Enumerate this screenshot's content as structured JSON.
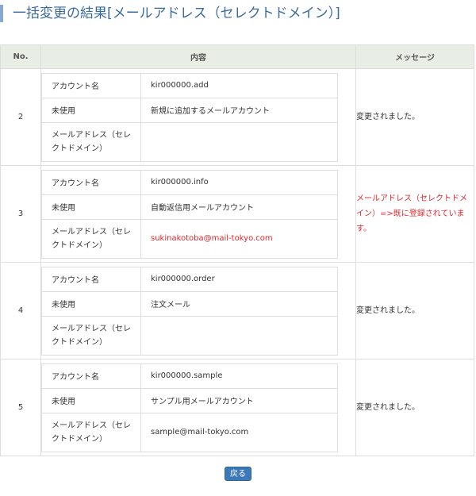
{
  "page": {
    "title": "一括変更の結果[メールアドレス（セレクトドメイン）]"
  },
  "table": {
    "headers": {
      "no": "No.",
      "content": "内容",
      "message": "メッセージ"
    },
    "field_labels": {
      "account": "アカウント名",
      "unused": "未使用",
      "email": "メールアドレス（セレクトドメイン）"
    },
    "rows": [
      {
        "no": "2",
        "account": "kir000000.add",
        "unused": "新規に追加するメールアカウント",
        "email": "",
        "message": "変更されました。"
      },
      {
        "no": "3",
        "account": "kir000000.info",
        "unused": "自動返信用メールアカウント",
        "email": "sukinakotoba@mail-tokyo.com",
        "message": "メールアドレス（セレクトドメイン）=>既に登録されています。"
      },
      {
        "no": "4",
        "account": "kir000000.order",
        "unused": "注文メール",
        "email": "",
        "message": "変更されました。"
      },
      {
        "no": "5",
        "account": "kir000000.sample",
        "unused": "サンプル用メールアカウント",
        "email": "sample@mail-tokyo.com",
        "message": "変更されました。"
      }
    ]
  },
  "colors": {
    "title": "#3a6b9f",
    "header_bg": "#e8eee6",
    "error": "#e0262b",
    "button": "#3b79b8"
  },
  "buttons": {
    "back_label": "戻る"
  }
}
